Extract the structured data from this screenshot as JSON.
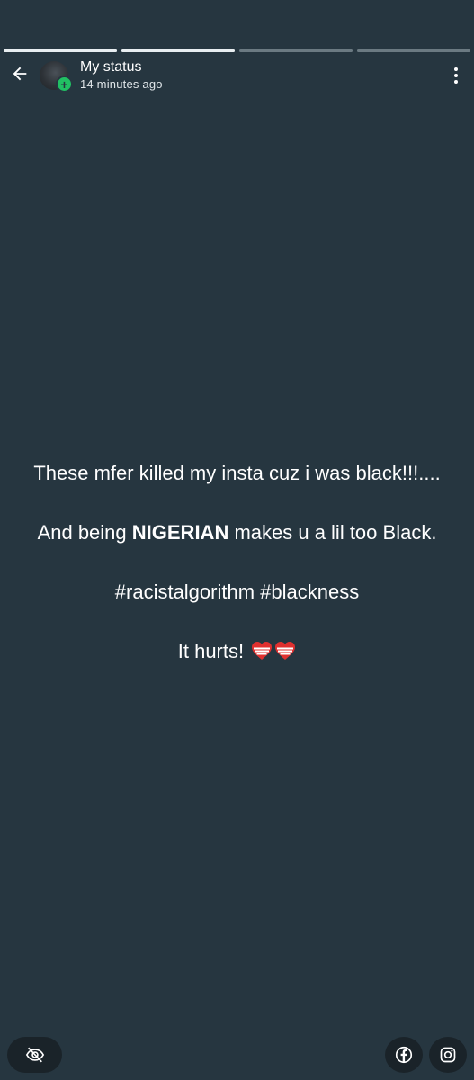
{
  "progress": [
    {
      "fraction": 1.0
    },
    {
      "fraction": 1.0
    },
    {
      "fraction": 0.0
    },
    {
      "fraction": 0.0
    }
  ],
  "header": {
    "title": "My status",
    "subtitle": "14 minutes ago",
    "back_icon": "arrow-left-icon",
    "menu_icon": "more-vert-icon",
    "add_icon": "plus-badge-icon"
  },
  "status": {
    "line1": "These mfer killed my insta cuz i was black!!!....",
    "line2_pre": "And being ",
    "line2_bold": "NIGERIAN",
    "line2_post": " makes u a lil too Black.",
    "line3": "#racistalgorithm #blackness",
    "line4": "It hurts! "
  },
  "footer": {
    "hide_icon": "eye-off-icon",
    "facebook_icon": "facebook-icon",
    "instagram_icon": "instagram-icon"
  },
  "colors": {
    "background": "#263640",
    "accent_green": "#21c063",
    "heart_red": "#e0302f"
  }
}
